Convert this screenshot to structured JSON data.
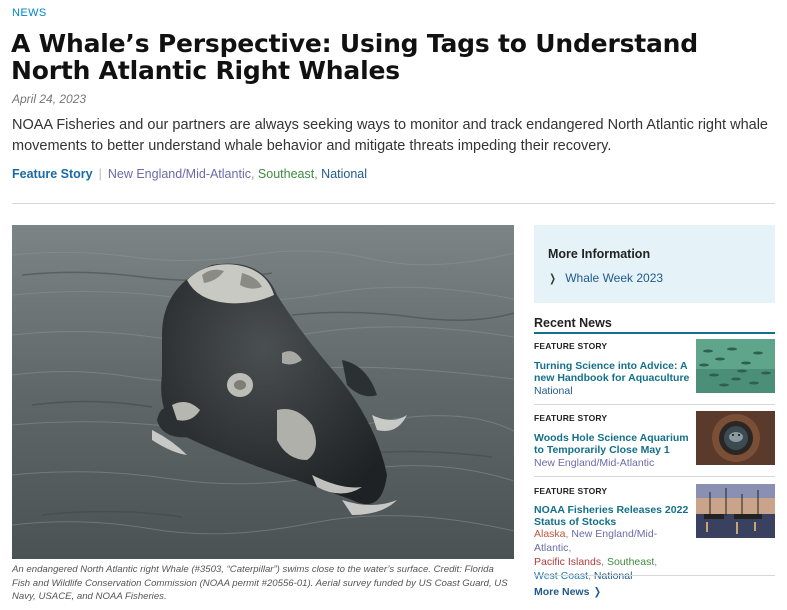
{
  "article": {
    "eyebrow": "NEWS",
    "title": "A Whale’s Perspective: Using Tags to Understand North Atlantic Right Whales",
    "date": "April 24, 2023",
    "summary": "NOAA Fisheries and our partners are always seeking ways to monitor and track endangered North Atlantic right whale movements to better understand whale behavior and mitigate threats impeding their recovery.",
    "type_label": "Feature Story",
    "regions": [
      "New England/Mid-Atlantic",
      "Southeast",
      "National"
    ],
    "caption": "An endangered North Atlantic right Whale (#3503, “Caterpillar”) swims close to the water’s surface. Credit: Florida Fish and Wildlife Conservation Commission (NOAA permit #20556-01). Aerial survey funded by US Coast Guard, US Navy, USACE, and NOAA Fisheries."
  },
  "sidebar": {
    "more_info": {
      "heading": "More Information",
      "link_label": "Whale Week 2023"
    },
    "recent_news": {
      "heading": "Recent News",
      "items": [
        {
          "kind": "FEATURE STORY",
          "title": "Turning Science into Advice: A new Handbook for Aquaculture",
          "regions": [
            "National"
          ]
        },
        {
          "kind": "FEATURE STORY",
          "title": "Woods Hole Science Aquarium to Temporarily Close May 1",
          "regions": [
            "New England/Mid-Atlantic"
          ]
        },
        {
          "kind": "FEATURE STORY",
          "title": "NOAA Fisheries Releases 2022 Status of Stocks",
          "regions": [
            "Alaska",
            "New England/Mid-Atlantic",
            "Pacific Islands",
            "Southeast",
            "West Coast",
            "National"
          ]
        }
      ],
      "more_label": "More News"
    }
  },
  "colors": {
    "accent": "#13708a",
    "link": "#1f5a8c",
    "info_box_bg": "#e5f3f8"
  }
}
